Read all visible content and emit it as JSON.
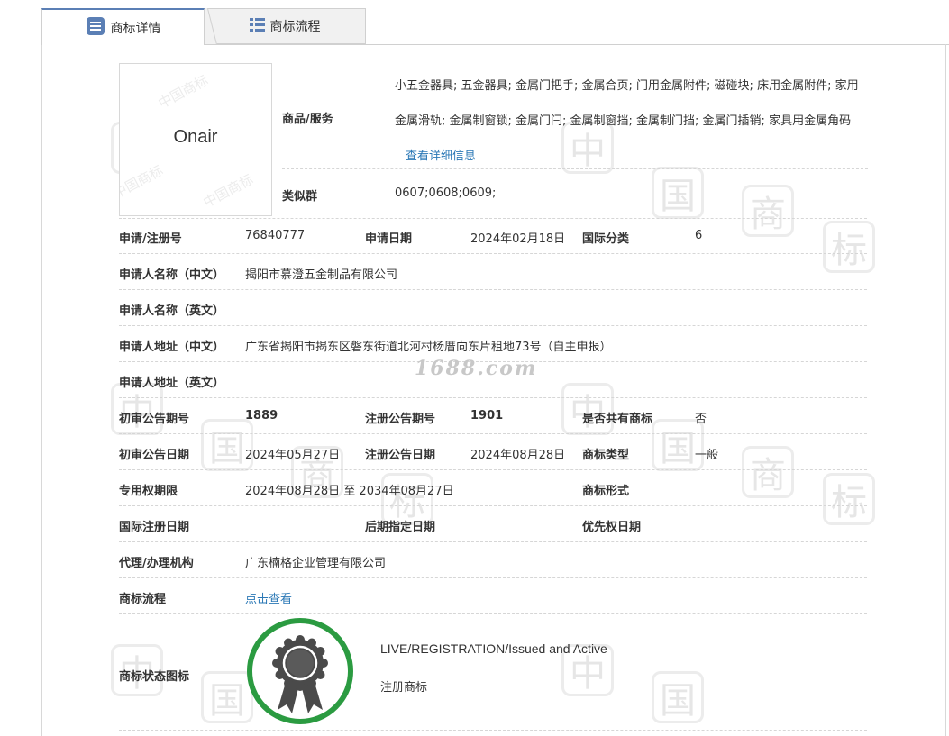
{
  "tabs": [
    {
      "label": "商标详情",
      "icon": "document-list-icon",
      "active": true
    },
    {
      "label": "商标流程",
      "icon": "list-icon",
      "active": false
    }
  ],
  "trademark_image": {
    "name": "Onair",
    "watermark": "中国商标"
  },
  "goods": {
    "label": "商品/服务",
    "text": "小五金器具; 五金器具; 金属门把手; 金属合页; 门用金属附件; 磁碰块; 床用金属附件; 家用金属滑轨; 金属制窗锁; 金属门闩; 金属制窗挡; 金属制门挡; 金属门插销; 家具用金属角码",
    "detail_link": "查看详细信息"
  },
  "similar_group": {
    "label": "类似群",
    "value": "0607;0608;0609;"
  },
  "rows": {
    "reg_no_label": "申请/注册号",
    "reg_no": "76840777",
    "apply_date_label": "申请日期",
    "apply_date": "2024年02月18日",
    "intl_class_label": "国际分类",
    "intl_class": "6",
    "applicant_cn_label": "申请人名称（中文）",
    "applicant_cn": "揭阳市慕澄五金制品有限公司",
    "applicant_en_label": "申请人名称（英文）",
    "applicant_en": "",
    "address_cn_label": "申请人地址（中文）",
    "address_cn": "广东省揭阳市揭东区磐东街道北河村杨厝向东片租地73号（自主申报）",
    "address_en_label": "申请人地址（英文）",
    "address_en": "",
    "prelim_no_label": "初审公告期号",
    "prelim_no": "1889",
    "reg_pub_no_label": "注册公告期号",
    "reg_pub_no": "1901",
    "shared_label": "是否共有商标",
    "shared": "否",
    "prelim_date_label": "初审公告日期",
    "prelim_date": "2024年05月27日",
    "reg_pub_date_label": "注册公告日期",
    "reg_pub_date": "2024年08月28日",
    "tm_type_label": "商标类型",
    "tm_type": "一般",
    "term_label": "专用权期限",
    "term": "2024年08月28日 至 2034年08月27日",
    "tm_form_label": "商标形式",
    "tm_form": "",
    "intl_reg_date_label": "国际注册日期",
    "later_date_label": "后期指定日期",
    "priority_date_label": "优先权日期",
    "agent_label": "代理/办理机构",
    "agent": "广东楠格企业管理有限公司",
    "flow_label": "商标流程",
    "flow_link": "点击查看",
    "status_icon_label": "商标状态图标",
    "status_en": "LIVE/REGISTRATION/Issued and Active",
    "status_cn": "注册商标"
  },
  "watermark_site": "1688.com",
  "colors": {
    "tab_active_border": "#5b7fb5",
    "link": "#2b78b6",
    "badge_ring": "#2b9b41",
    "badge_medal": "#4a4a4a"
  }
}
